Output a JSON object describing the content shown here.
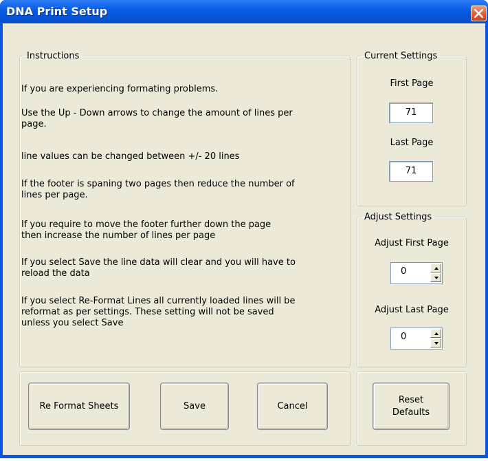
{
  "window": {
    "title": "DNA Print Setup"
  },
  "instructions": {
    "legend": "Instructions",
    "paragraphs": [
      [
        "If you are experiencing formating problems."
      ],
      [
        "Use the Up - Down arrows to change the amount of lines per",
        "page."
      ],
      [
        "line values can be changed between  +/- 20 lines"
      ],
      [
        "If the footer is spaning two pages then reduce the number of",
        "lines per page."
      ],
      [
        "If you require to move the footer further down the page",
        "then increase the number of lines per page"
      ],
      [
        "If you select Save the line data will clear and you will have to",
        "reload the data"
      ],
      [
        "If you select Re-Format Lines all currently loaded lines will be",
        "reformat as per settings. These setting will not be saved",
        "unless you select Save"
      ]
    ]
  },
  "current_settings": {
    "legend": "Current Settings",
    "first_page_label": "First Page",
    "first_page_value": "71",
    "last_page_label": "Last Page",
    "last_page_value": "71"
  },
  "adjust_settings": {
    "legend": "Adjust Settings",
    "first_label": "Adjust First Page",
    "first_value": "0",
    "last_label": "Adjust Last Page",
    "last_value": "0"
  },
  "buttons": {
    "reformat": "Re Format Sheets",
    "save": "Save",
    "cancel": "Cancel",
    "reset_line1": "Reset",
    "reset_line2": "Defaults"
  }
}
